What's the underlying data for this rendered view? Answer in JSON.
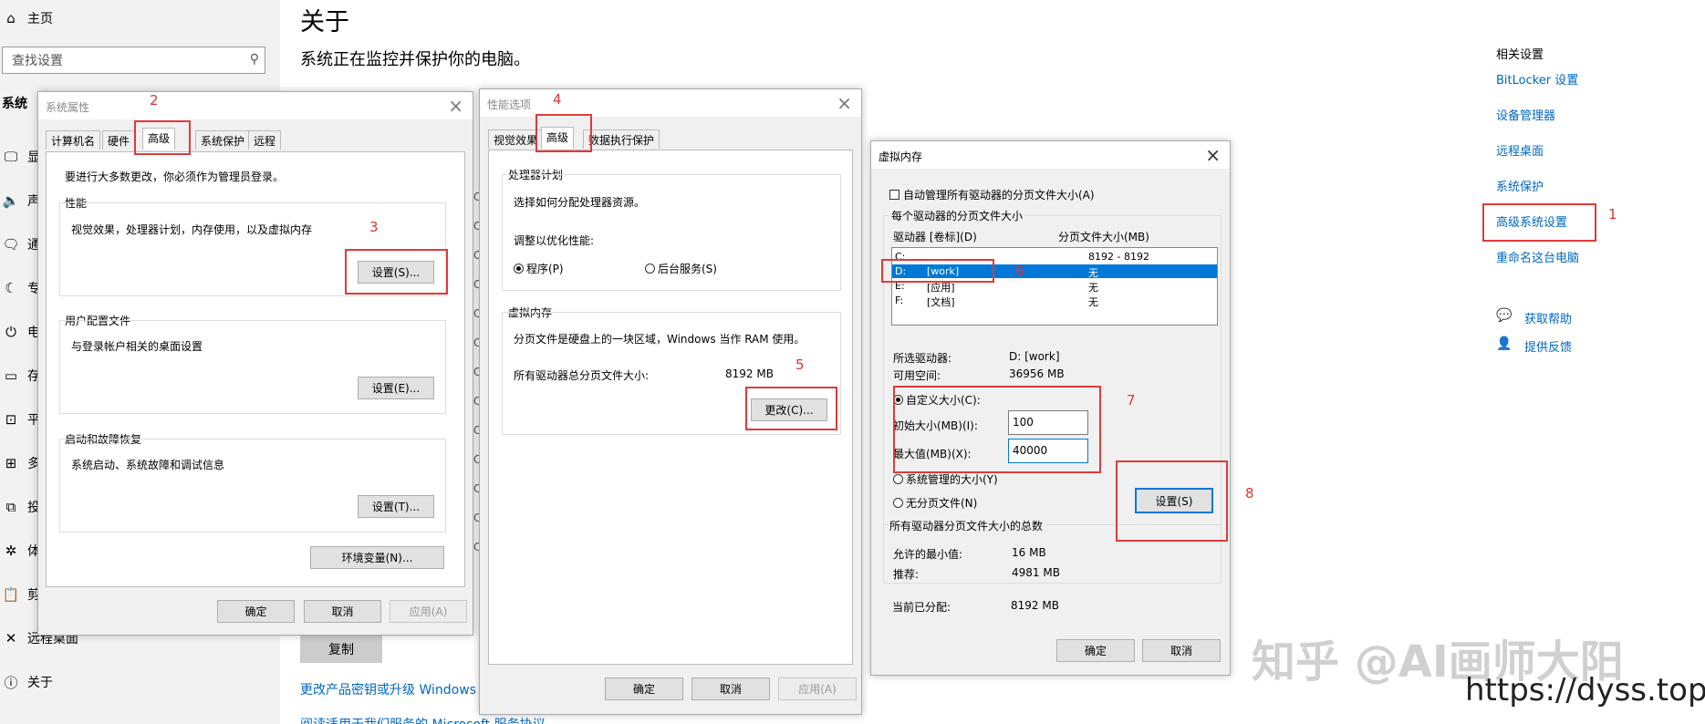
{
  "sidebar": {
    "home": "主页",
    "search_placeholder": "查找设置",
    "section": "系统",
    "items": [
      {
        "label": "显"
      },
      {
        "label": "声"
      },
      {
        "label": "通"
      },
      {
        "label": "专"
      },
      {
        "label": "电"
      },
      {
        "label": "存"
      },
      {
        "label": "平"
      },
      {
        "label": "多"
      },
      {
        "label": "投"
      },
      {
        "label": "体"
      },
      {
        "label": "剪"
      },
      {
        "label": "远程桌面"
      },
      {
        "label": "关于"
      }
    ]
  },
  "main": {
    "title": "关于",
    "subtitle": "系统正在监控并保护你的电脑。",
    "copy_button": "复制",
    "link_upgrade": "更改产品密钥或升级 Windows",
    "link_terms": "阅读适用于我们服务的 Microsoft 服务协议"
  },
  "related": {
    "heading": "相关设置",
    "links": [
      "BitLocker 设置",
      "设备管理器",
      "远程桌面",
      "系统保护",
      "高级系统设置",
      "重命名这台电脑"
    ],
    "help": "获取帮助",
    "feedback": "提供反馈"
  },
  "sysprops": {
    "title": "系统属性",
    "tabs": [
      "计算机名",
      "硬件",
      "高级",
      "系统保护",
      "远程"
    ],
    "admin_note": "要进行大多数更改，你必须作为管理员登录。",
    "perf_label": "性能",
    "perf_desc": "视觉效果，处理器计划，内存使用，以及虚拟内存",
    "perf_btn": "设置(S)...",
    "profile_label": "用户配置文件",
    "profile_desc": "与登录帐户相关的桌面设置",
    "profile_btn": "设置(E)...",
    "startup_label": "启动和故障恢复",
    "startup_desc": "系统启动、系统故障和调试信息",
    "startup_btn": "设置(T)...",
    "env_btn": "环境变量(N)...",
    "ok": "确定",
    "cancel": "取消",
    "apply": "应用(A)"
  },
  "perfopts": {
    "title": "性能选项",
    "tabs": [
      "视觉效果",
      "高级",
      "数据执行保护"
    ],
    "sched_label": "处理器计划",
    "sched_desc": "选择如何分配处理器资源。",
    "adjust": "调整以优化性能:",
    "opt_programs": "程序(P)",
    "opt_services": "后台服务(S)",
    "vm_label": "虚拟内存",
    "vm_desc": "分页文件是硬盘上的一块区域，Windows 当作 RAM 使用。",
    "total_label": "所有驱动器总分页文件大小:",
    "total_value": "8192 MB",
    "change_btn": "更改(C)...",
    "ok": "确定",
    "cancel": "取消",
    "apply": "应用(A)"
  },
  "vm": {
    "title": "虚拟内存",
    "auto_manage": "自动管理所有驱动器的分页文件大小(A)",
    "per_drive": "每个驱动器的分页文件大小",
    "col_drive": "驱动器 [卷标](D)",
    "col_size": "分页文件大小(MB)",
    "drives": [
      {
        "drive": "C:",
        "label": "",
        "size": "8192 - 8192"
      },
      {
        "drive": "D:",
        "label": "[work]",
        "size": "无"
      },
      {
        "drive": "E:",
        "label": "[应用]",
        "size": "无"
      },
      {
        "drive": "F:",
        "label": "[文档]",
        "size": "无"
      }
    ],
    "selected_drive_label": "所选驱动器:",
    "selected_drive": "D:  [work]",
    "free_label": "可用空间:",
    "free": "36956 MB",
    "custom": "自定义大小(C):",
    "initial_label": "初始大小(MB)(I):",
    "initial": "100",
    "max_label": "最大值(MB)(X):",
    "max": "40000",
    "system_managed": "系统管理的大小(Y)",
    "no_paging": "无分页文件(N)",
    "set_btn": "设置(S)",
    "totals_label": "所有驱动器分页文件大小的总数",
    "min_label": "允许的最小值:",
    "min": "16 MB",
    "rec_label": "推荐:",
    "rec": "4981 MB",
    "cur_label": "当前已分配:",
    "cur": "8192 MB",
    "ok": "确定",
    "cancel": "取消"
  },
  "annotations": [
    "1",
    "2",
    "3",
    "4",
    "5",
    "6",
    "7",
    "8"
  ],
  "watermark": {
    "brand": "知乎 @AI画师大阳",
    "url": "https://dyss.top"
  }
}
